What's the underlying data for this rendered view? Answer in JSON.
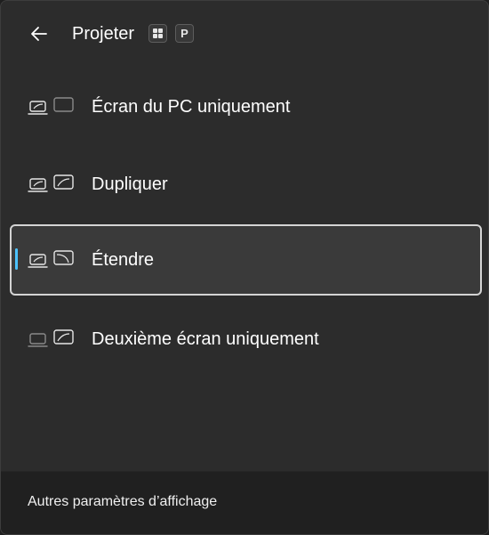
{
  "header": {
    "back_icon": "back-arrow-icon",
    "title": "Projeter",
    "shortcut": {
      "modifier_icon": "windows-key-icon",
      "key": "P"
    }
  },
  "options": [
    {
      "label": "Écran du PC uniquement",
      "icon": "pc-screen-only-icon",
      "selected": false
    },
    {
      "label": "Dupliquer",
      "icon": "duplicate-icon",
      "selected": false
    },
    {
      "label": "Étendre",
      "icon": "extend-icon",
      "selected": true
    },
    {
      "label": "Deuxième écran uniquement",
      "icon": "second-screen-only-icon",
      "selected": false
    }
  ],
  "footer": {
    "link_label": "Autres paramètres d’affichage"
  },
  "colors": {
    "panel_background": "#2c2c2c",
    "footer_background": "#202020",
    "selected_background": "#3a3a3a",
    "selection_border": "#d4d4d4",
    "accent": "#4cc2ff",
    "text": "#ffffff"
  }
}
